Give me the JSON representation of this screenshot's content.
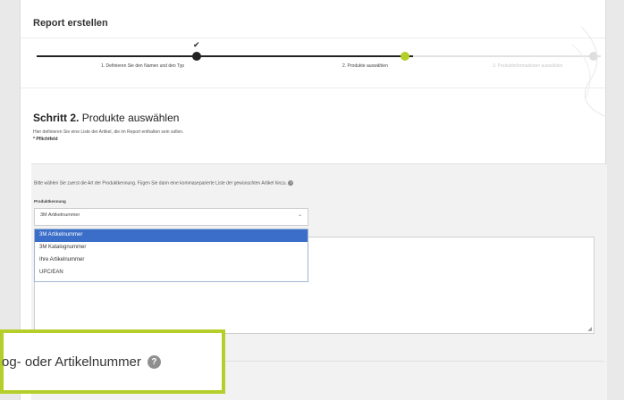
{
  "page": {
    "title": "Report erstellen"
  },
  "stepper": {
    "checkmark": "✔",
    "steps": [
      {
        "label": "1. Definieren Sie den Namen und den Typ",
        "state": "done"
      },
      {
        "label": "2. Produkte auswählen",
        "state": "current"
      },
      {
        "label": "3. Produktinformationen auswählen",
        "state": "todo"
      }
    ],
    "accent_color": "#b6ce2a"
  },
  "section": {
    "step_prefix": "Schritt 2.",
    "heading": "Produkte auswählen",
    "description": "Hier definieren Sie eine Liste der Artikel, die im Report enthalten sein sollen.",
    "required_note": "* Pflichtfeld"
  },
  "form": {
    "instruction": "Bitte wählen Sie zuerst die Art der Produktkennung. Fügen Sie dann eine kommaseparierte Liste der gewünschten Artikel hinzu.",
    "help_icon": "?",
    "field_label": "Produktkennung",
    "select_value": "3M Artikelnummer",
    "select_chevron": "⌃",
    "options": [
      "3M Artikelnummer",
      "3M Katalognummer",
      "Ihre Artikelnummer",
      "UPC/EAN"
    ],
    "selected_option_color": "#3b6ec8"
  },
  "callout": {
    "text": "og- oder Artikelnummer",
    "help_icon": "?",
    "border_color": "#b6ce2a"
  }
}
